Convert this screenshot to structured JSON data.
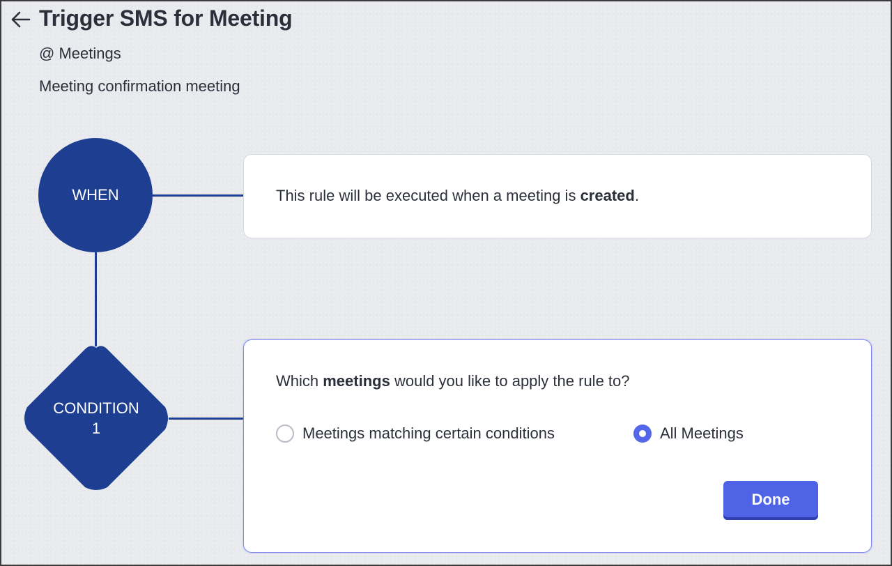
{
  "header": {
    "back_icon": "arrow-left-icon",
    "title": "Trigger SMS for Meeting",
    "module": "@ Meetings",
    "description": "Meeting confirmation meeting"
  },
  "flow": {
    "when_node_label": "WHEN",
    "condition_node_label_line1": "CONDITION",
    "condition_node_label_line2": "1",
    "node_color": "#1e3f91"
  },
  "when_card": {
    "text_before": "This rule will be executed when a meeting is ",
    "text_bold": "created",
    "text_after": "."
  },
  "condition_card": {
    "question_before": "Which ",
    "question_bold": "meetings",
    "question_after": " would you like to apply the rule to?",
    "options": [
      {
        "label": "Meetings matching certain conditions",
        "selected": false
      },
      {
        "label": "All Meetings",
        "selected": true
      }
    ],
    "done_label": "Done",
    "accent_color": "#4f63e6"
  }
}
